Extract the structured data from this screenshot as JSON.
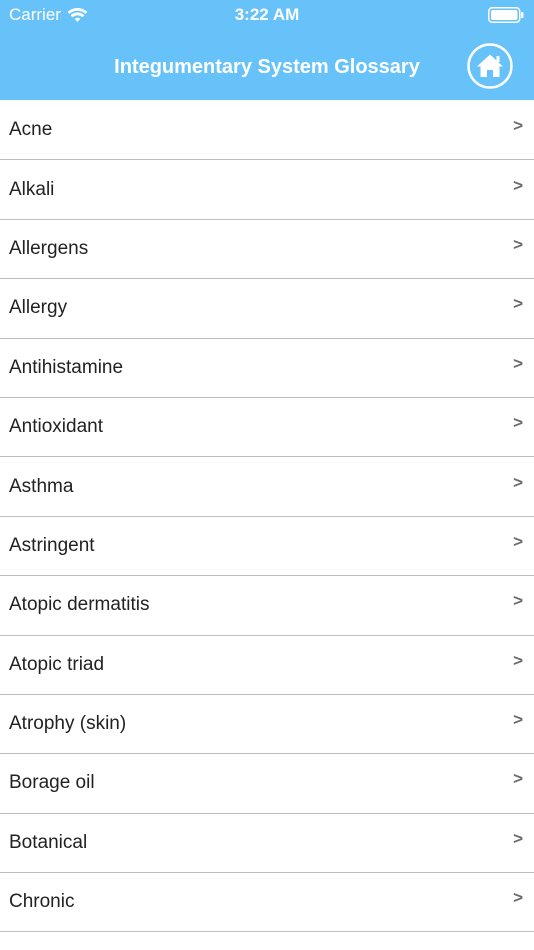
{
  "status_bar": {
    "carrier": "Carrier",
    "time": "3:22 AM"
  },
  "nav": {
    "title": "Integumentary System Glossary",
    "home_icon": "home-icon"
  },
  "colors": {
    "header_bg": "#66c2f9",
    "header_text": "#ffffff",
    "row_text": "#222222",
    "separator": "#bcbcbc"
  },
  "glossary": {
    "chevron": ">",
    "items": [
      {
        "label": "Acne"
      },
      {
        "label": "Alkali"
      },
      {
        "label": "Allergens"
      },
      {
        "label": "Allergy"
      },
      {
        "label": "Antihistamine"
      },
      {
        "label": "Antioxidant"
      },
      {
        "label": "Asthma"
      },
      {
        "label": "Astringent"
      },
      {
        "label": "Atopic dermatitis"
      },
      {
        "label": "Atopic triad"
      },
      {
        "label": "Atrophy (skin)"
      },
      {
        "label": "Borage oil"
      },
      {
        "label": "Botanical"
      },
      {
        "label": "Chronic"
      }
    ]
  }
}
